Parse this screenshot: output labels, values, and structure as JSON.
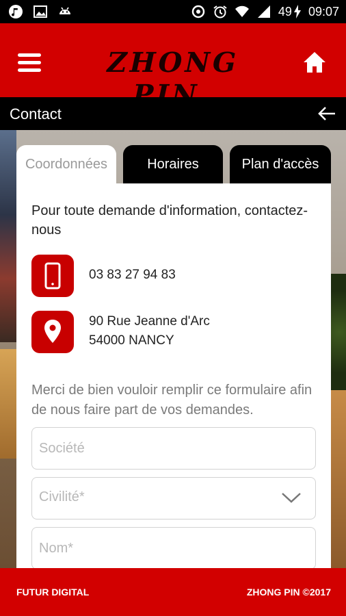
{
  "status_bar": {
    "battery": "49",
    "time": "09:07",
    "icons": [
      "music-icon",
      "image-icon",
      "android-icon",
      "data-saver-icon",
      "alarm-icon",
      "wifi-icon",
      "signal-icon",
      "battery-charging-icon"
    ]
  },
  "header": {
    "brand": "ZHONG PIN",
    "menu_icon": "hamburger-menu-icon",
    "home_icon": "home-icon"
  },
  "title_bar": {
    "title": "Contact",
    "back_icon": "arrow-left-icon"
  },
  "tabs": [
    {
      "label": "Coordonnées",
      "active": true
    },
    {
      "label": "Horaires",
      "active": false
    },
    {
      "label": "Plan d'accès",
      "active": false
    }
  ],
  "contact": {
    "intro": "Pour toute demande d'information, contactez-nous",
    "phone": "03 83 27 94 83",
    "address_line1": "90 Rue Jeanne d'Arc",
    "address_line2": "54000 NANCY"
  },
  "form": {
    "intro": "Merci de bien vouloir remplir ce formulaire afin de nous faire part de vos demandes.",
    "societe_placeholder": "Société",
    "civilite_value": "Civilité*",
    "nom_placeholder": "Nom*"
  },
  "footer": {
    "left": "FUTUR DIGITAL",
    "right": "ZHONG PIN ©2017"
  },
  "colors": {
    "brand_red": "#d20000",
    "icon_red": "#c80000",
    "bar_black": "#000000"
  }
}
